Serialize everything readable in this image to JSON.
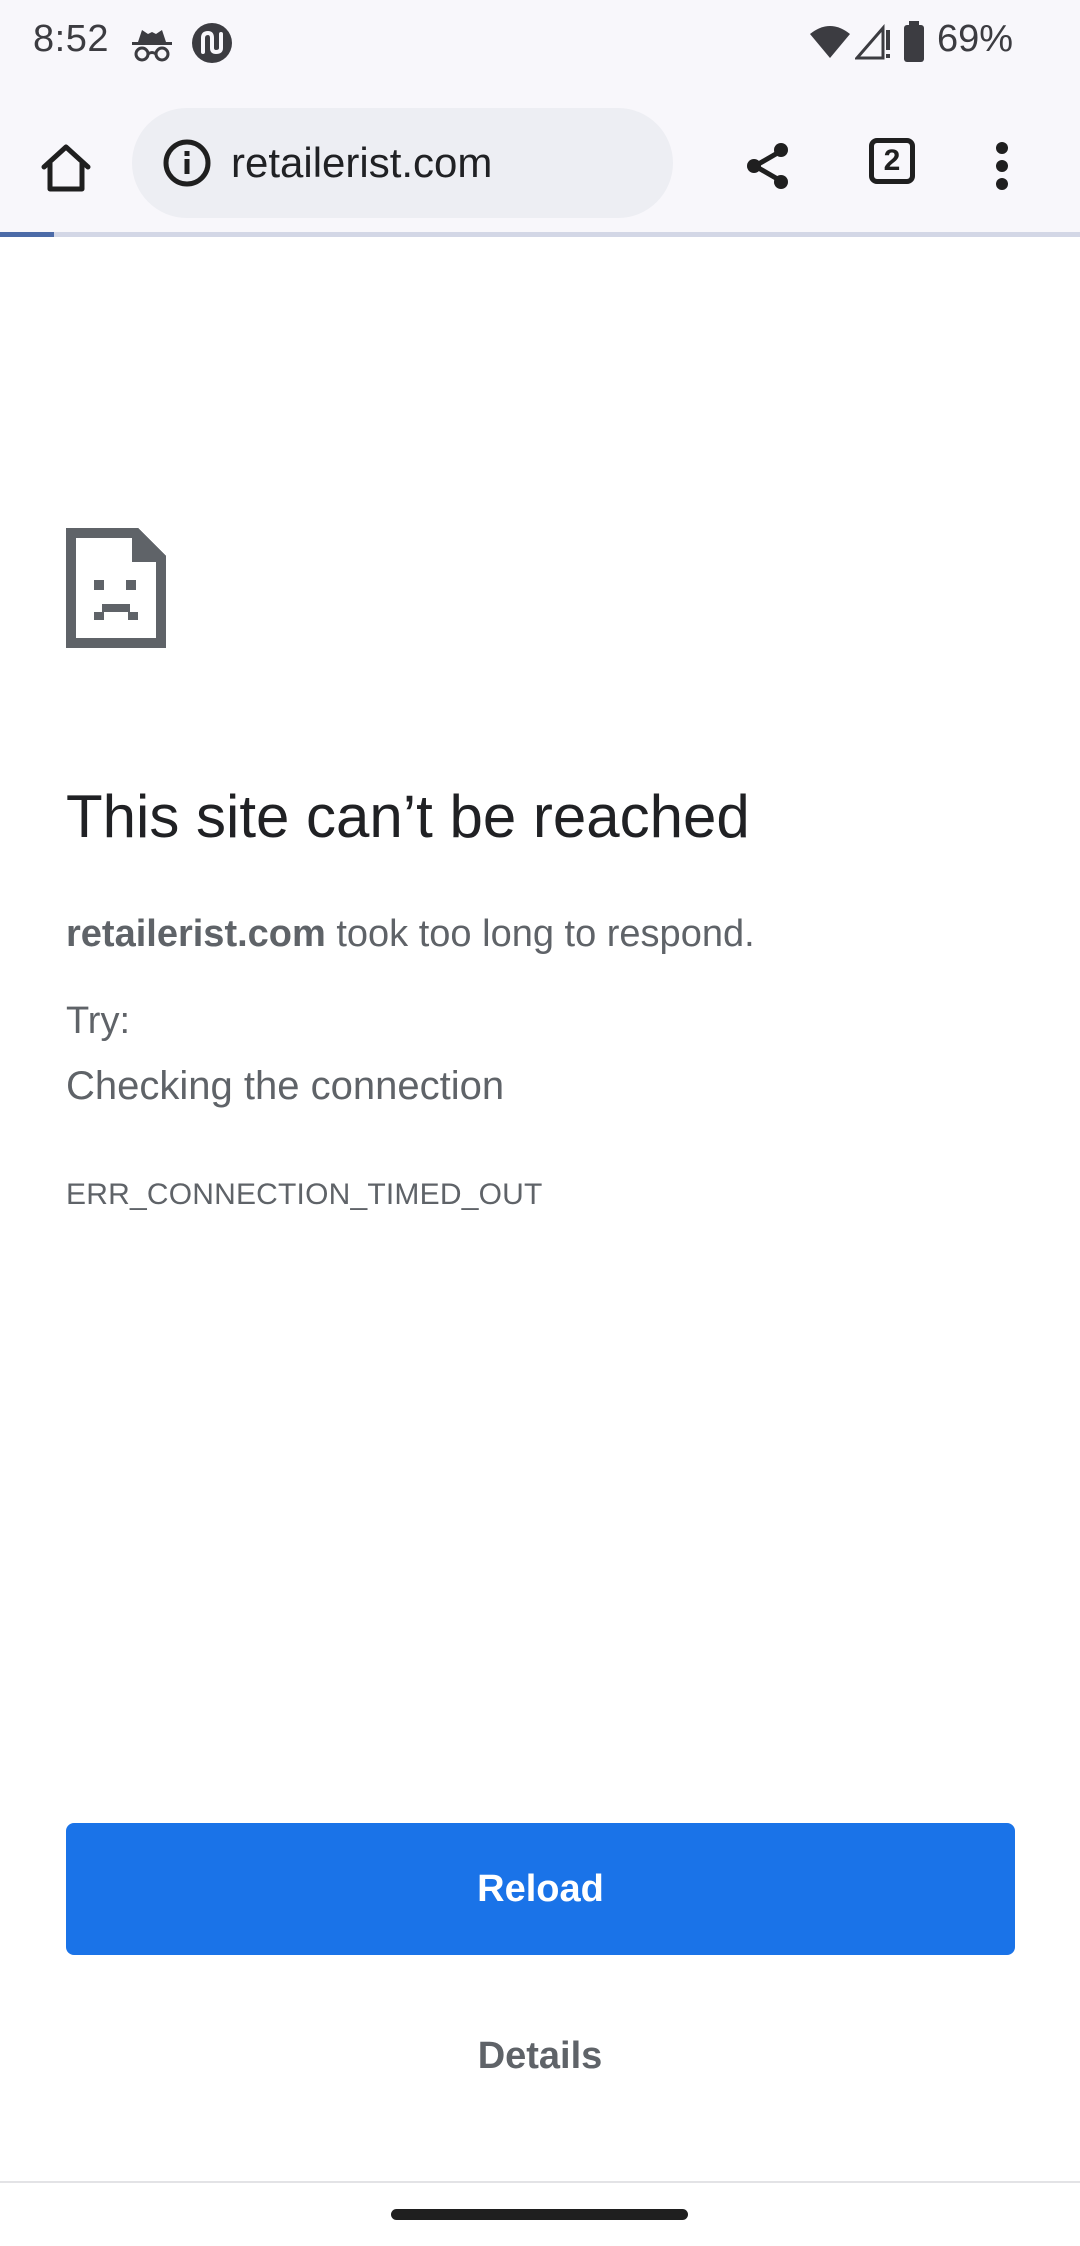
{
  "status_bar": {
    "time": "8:52",
    "notification_icons": [
      "incognito-icon",
      "app-notification-icon"
    ],
    "system_icons": [
      "wifi-icon",
      "cell-signal-icon",
      "battery-icon"
    ],
    "battery_percent": "69%"
  },
  "toolbar": {
    "home_icon": "home-icon",
    "site_info_icon": "info-icon",
    "url": "retailerist.com",
    "share_icon": "share-icon",
    "tab_count": "2",
    "menu_icon": "more-vert-icon",
    "load_progress": 0.05
  },
  "error_page": {
    "icon": "sad-document-icon",
    "title": "This site can’t be reached",
    "host": "retailerist.com",
    "message_rest": " took too long to respond.",
    "try_label": "Try:",
    "suggestions": [
      "Checking the connection"
    ],
    "error_code": "ERR_CONNECTION_TIMED_OUT",
    "reload_label": "Reload",
    "details_label": "Details"
  },
  "colors": {
    "accent": "#1a73e8",
    "chrome_background": "#f8f7fb",
    "omnibox_background": "#edeef3",
    "secondary_text": "#5f6368"
  }
}
